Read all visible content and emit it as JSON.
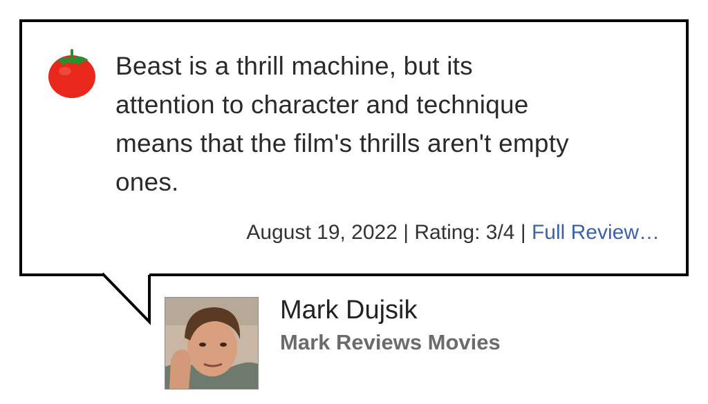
{
  "review": {
    "quote_lines": [
      "Beast is a thrill machine, but its",
      "attention to character and technique",
      "means that the film's thrills aren't empty",
      "ones."
    ],
    "date": "August 19, 2022",
    "separator": " | ",
    "rating": "Rating: 3/4",
    "full_review_label": "Full Review…",
    "score_icon": "fresh-tomato-icon"
  },
  "critic": {
    "name": "Mark Dujsik",
    "publication": "Mark Reviews Movies"
  },
  "colors": {
    "border": "#000000",
    "tomato": "#e8281a",
    "stem": "#2e8b2e",
    "link": "#3a62b0",
    "publication": "#6b6b6b"
  }
}
